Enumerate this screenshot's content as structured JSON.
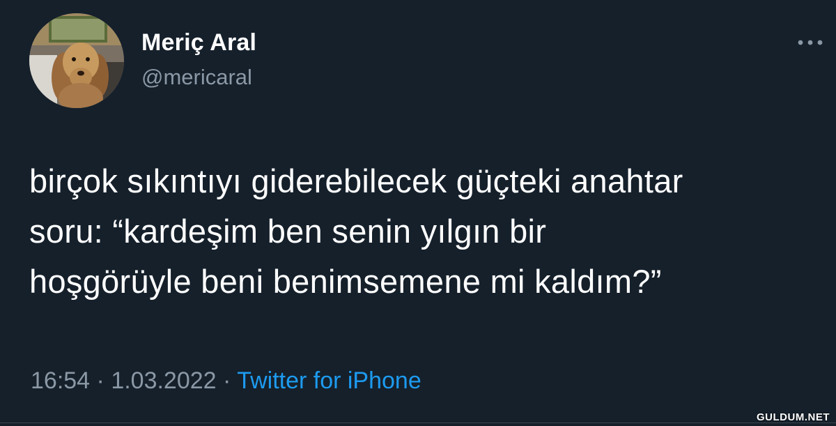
{
  "author": {
    "display_name": "Meriç Aral",
    "handle": "@mericaral",
    "avatar_icon": "dog-avatar"
  },
  "more_icon": "more-icon",
  "tweet": {
    "lines": [
      "birçok sıkıntıyı giderebilecek güçteki anahtar",
      "soru: “kardeşim ben senin yılgın bir",
      "hoşgörüyle beni benimsemene mi kaldım?”"
    ]
  },
  "meta": {
    "time": "16:54",
    "separator1": " · ",
    "date": "1.03.2022",
    "separator2": " · ",
    "source": "Twitter for iPhone"
  },
  "watermark": "GULDUM.NET",
  "colors": {
    "background": "#15202b",
    "text": "#ffffff",
    "secondary": "#8b98a5",
    "link": "#1d9bf0"
  }
}
